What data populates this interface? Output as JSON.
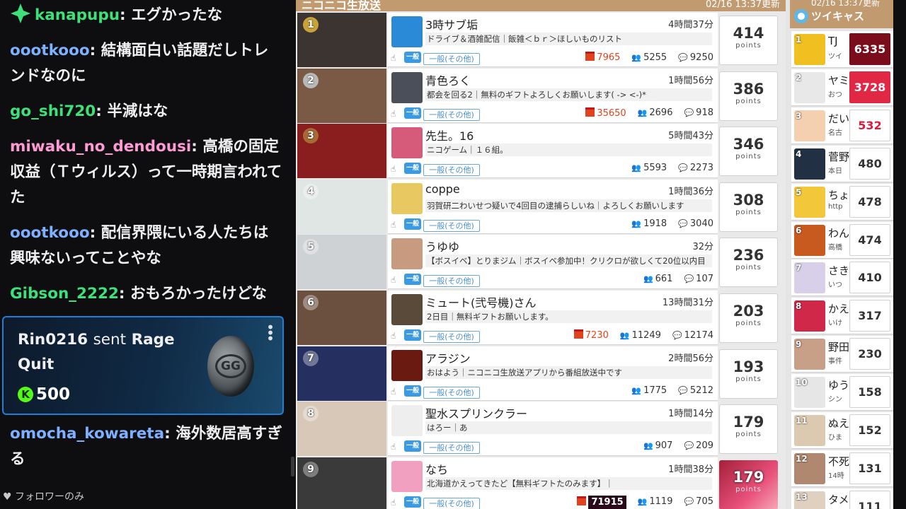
{
  "chat": {
    "messages": [
      {
        "user": "kanapupu",
        "color": "#2ecc71",
        "text": "エグかったな",
        "badge": "gem"
      },
      {
        "user": "oootkooo",
        "color": "#6fa8ff",
        "text": "結構面白い話題だしトレンドなのに"
      },
      {
        "user": "go_shi720",
        "color": "#3ee07a",
        "text": "半減はな"
      },
      {
        "user": "miwaku_no_dendousi",
        "color": "#ff9ad5",
        "text": "高橋の固定収益（Ｔウィルス）って一時期言われてた"
      },
      {
        "user": "oootkooo",
        "color": "#6fa8ff",
        "text": "配信界隈にいる人たちは興味ないってことやな"
      },
      {
        "user": "Gibson_2222",
        "color": "#3ee07a",
        "text": "おもろかったけどな"
      },
      {
        "user": "omocha_kowareta",
        "color": "#6fa8ff",
        "text": "海外数居高すぎる"
      }
    ],
    "gift": {
      "user": "Rin0216",
      "sent": "sent",
      "item": "Rage Quit",
      "amount": "500",
      "coin_label": "GG"
    },
    "footer": "フォロワーのみ"
  },
  "ranking": {
    "header_title": "ニコニコ生放送",
    "updated": "02/16 13:37更新",
    "points_unit": "points",
    "rows": [
      {
        "rank": "1",
        "name": "3時サブ垢",
        "duration": "4時間37分",
        "desc": "ドライブ＆酒雑配信｜飯雑＜ｂｒ＞ほしいものリスト",
        "category": "一般(その他)",
        "gift": "7965",
        "viewers": "5255",
        "comments": "9250",
        "points": "414"
      },
      {
        "rank": "2",
        "name": "青色ろく",
        "duration": "1時間56分",
        "desc": "都会を回る2｜無料のギフトよろしくお願いします( -> <-)*",
        "category": "一般(その他)",
        "gift": "35650",
        "viewers": "2696",
        "comments": "918",
        "points": "386"
      },
      {
        "rank": "3",
        "name": "先生。16",
        "duration": "5時間43分",
        "desc": "ニコゲーム｜１６組。",
        "category": "一般(その他)",
        "gift": "",
        "viewers": "5593",
        "comments": "2273",
        "points": "346"
      },
      {
        "rank": "4",
        "name": "coppe",
        "duration": "1時間36分",
        "desc": "羽賀研二わいせつ疑いで4回目の逮捕らしいね｜よろしくお願いします",
        "category": "一般(その他)",
        "gift": "",
        "viewers": "1918",
        "comments": "3040",
        "points": "308"
      },
      {
        "rank": "5",
        "name": "うゆゆ",
        "duration": "32分",
        "desc": "【ボスイベ】とりまジム｜ボスイベ参加中！クリクロが欲しくて20位以内目",
        "category": "一般(その他)",
        "gift": "",
        "viewers": "661",
        "comments": "107",
        "points": "236"
      },
      {
        "rank": "6",
        "name": "ミュート(弐号機)さん",
        "duration": "13時間31分",
        "desc": "2日目｜無料ギフトお願いします。",
        "category": "一般(その他)",
        "gift": "7230",
        "viewers": "11249",
        "comments": "12174",
        "points": "203"
      },
      {
        "rank": "7",
        "name": "アラジン",
        "duration": "2時間56分",
        "desc": "おはよう｜ニコニコ生放送アプリから番組放送中です",
        "category": "一般(その他)",
        "gift": "",
        "viewers": "1775",
        "comments": "5212",
        "points": "193"
      },
      {
        "rank": "8",
        "name": "聖水スプリンクラー",
        "duration": "1時間14分",
        "desc": "はろー｜あ",
        "category": "一般(その他)",
        "gift": "",
        "viewers": "907",
        "comments": "209",
        "points": "179"
      },
      {
        "rank": "9",
        "name": "なち",
        "duration": "1時間38分",
        "desc": "北海道かえってきたど【無料ギフトたのみます】｜",
        "category": "一般(その他)",
        "gift": "71915",
        "viewers": "1119",
        "comments": "705",
        "points": "179"
      }
    ],
    "badge_label": "一般"
  },
  "twicas": {
    "title": "ツイキャス",
    "updated": "02/16 13:37更新",
    "rows": [
      {
        "rank": "1",
        "name": "TJ",
        "sub": "ツイ",
        "points": "6335",
        "style": "dark"
      },
      {
        "rank": "2",
        "name": "ヤミ",
        "sub": "おつ",
        "points": "3728",
        "style": "red"
      },
      {
        "rank": "3",
        "name": "だい",
        "sub": "名古",
        "points": "532",
        "style": "redtxt"
      },
      {
        "rank": "4",
        "name": "菅野",
        "sub": "本日",
        "points": "480",
        "style": ""
      },
      {
        "rank": "5",
        "name": "ちょ",
        "sub": "http",
        "points": "478",
        "style": ""
      },
      {
        "rank": "6",
        "name": "わん",
        "sub": "高橋",
        "points": "474",
        "style": ""
      },
      {
        "rank": "7",
        "name": "さき",
        "sub": "いつ",
        "points": "410",
        "style": ""
      },
      {
        "rank": "8",
        "name": "かえ",
        "sub": "いけ",
        "points": "317",
        "style": ""
      },
      {
        "rank": "9",
        "name": "野田",
        "sub": "事件",
        "points": "230",
        "style": ""
      },
      {
        "rank": "10",
        "name": "ゆう",
        "sub": "シン",
        "points": "158",
        "style": ""
      },
      {
        "rank": "11",
        "name": "ぬえ",
        "sub": "ひま",
        "points": "152",
        "style": ""
      },
      {
        "rank": "12",
        "name": "不死",
        "sub": "14時",
        "points": "131",
        "style": ""
      },
      {
        "rank": "13",
        "name": "タメ",
        "sub": "",
        "points": "111",
        "style": ""
      }
    ]
  }
}
